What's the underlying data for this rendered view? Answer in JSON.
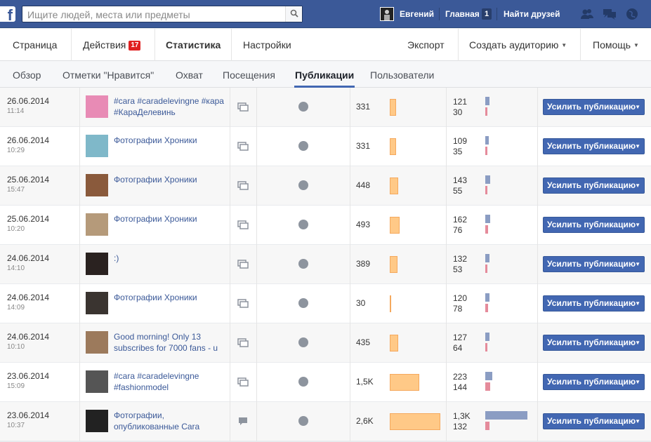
{
  "header": {
    "logo": "f",
    "search_placeholder": "Ищите людей, места или предметы",
    "user_name": "Евгений",
    "home_label": "Главная",
    "home_count": "1",
    "find_friends_label": "Найти друзей",
    "colors": {
      "bar": "#3b5998"
    }
  },
  "page_nav": {
    "page": "Страница",
    "actions": "Действия",
    "actions_badge": "17",
    "stats": "Статистика",
    "settings": "Настройки",
    "export": "Экспорт",
    "create_audience": "Создать аудиторию",
    "help": "Помощь"
  },
  "sub_tabs": {
    "overview": "Обзор",
    "likes": "Отметки \"Нравится\"",
    "reach": "Охват",
    "visits": "Посещения",
    "posts": "Публикации",
    "users": "Пользователи"
  },
  "boost_label": "Усилить публикацию",
  "posts": [
    {
      "date": "26.06.2014",
      "time": "11:14",
      "text": "#cara #caradelevingne #кара #КараДелевинь",
      "type": "album",
      "reach": "331",
      "reach_value": 331,
      "eng1": "121",
      "eng1_value": 121,
      "eng2": "30",
      "eng2_value": 30,
      "thumb_color": "#e88bb5"
    },
    {
      "date": "26.06.2014",
      "time": "10:29",
      "text": "Фотографии Хроники",
      "type": "album",
      "reach": "331",
      "reach_value": 331,
      "eng1": "109",
      "eng1_value": 109,
      "eng2": "35",
      "eng2_value": 35,
      "thumb_color": "#7fb8c9"
    },
    {
      "date": "25.06.2014",
      "time": "15:47",
      "text": "Фотографии Хроники",
      "type": "album",
      "reach": "448",
      "reach_value": 448,
      "eng1": "143",
      "eng1_value": 143,
      "eng2": "55",
      "eng2_value": 55,
      "thumb_color": "#8a5a3c"
    },
    {
      "date": "25.06.2014",
      "time": "10:20",
      "text": "Фотографии Хроники",
      "type": "album",
      "reach": "493",
      "reach_value": 493,
      "eng1": "162",
      "eng1_value": 162,
      "eng2": "76",
      "eng2_value": 76,
      "thumb_color": "#b59a7a"
    },
    {
      "date": "24.06.2014",
      "time": "14:10",
      "text": ":)",
      "type": "album",
      "reach": "389",
      "reach_value": 389,
      "eng1": "132",
      "eng1_value": 132,
      "eng2": "53",
      "eng2_value": 53,
      "thumb_color": "#2a2220"
    },
    {
      "date": "24.06.2014",
      "time": "14:09",
      "text": "Фотографии Хроники",
      "type": "album",
      "reach": "30",
      "reach_value": 30,
      "eng1": "120",
      "eng1_value": 120,
      "eng2": "78",
      "eng2_value": 78,
      "thumb_color": "#3a3430"
    },
    {
      "date": "24.06.2014",
      "time": "10:10",
      "text": "Good morning! Only 13 subscribes for 7000 fans - u",
      "type": "album",
      "reach": "435",
      "reach_value": 435,
      "eng1": "127",
      "eng1_value": 127,
      "eng2": "64",
      "eng2_value": 64,
      "thumb_color": "#9c7a5c"
    },
    {
      "date": "23.06.2014",
      "time": "15:09",
      "text": "#cara #caradelevingne #fashionmodel",
      "type": "album",
      "reach": "1,5K",
      "reach_value": 1500,
      "eng1": "223",
      "eng1_value": 223,
      "eng2": "144",
      "eng2_value": 144,
      "thumb_color": "#555"
    },
    {
      "date": "23.06.2014",
      "time": "10:37",
      "text": "Фотографии, опубликованные Cara",
      "type": "status",
      "reach": "2,6K",
      "reach_value": 2600,
      "eng1": "1,3K",
      "eng1_value": 1300,
      "eng2": "132",
      "eng2_value": 132,
      "thumb_color": "#222"
    }
  ]
}
